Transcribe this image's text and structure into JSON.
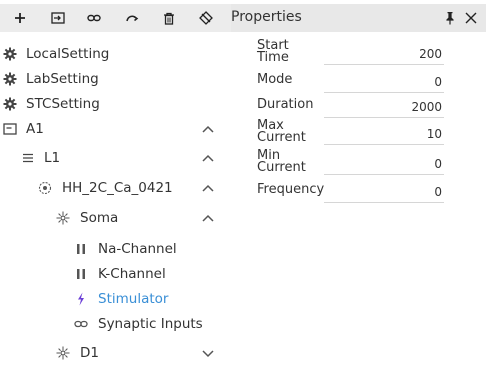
{
  "toolbar": {
    "buttons": [
      "add-icon",
      "import-icon",
      "link-icon",
      "redo-icon",
      "delete-icon",
      "clear-icon"
    ]
  },
  "tree": {
    "items": [
      {
        "label": "LocalSetting",
        "icon": "gear-icon"
      },
      {
        "label": "LabSetting",
        "icon": "gear-icon"
      },
      {
        "label": "STCSetting",
        "icon": "gear-icon"
      },
      {
        "label": "A1",
        "icon": "window-icon",
        "expanded": true
      },
      {
        "label": "L1",
        "icon": "list-icon",
        "expanded": true
      },
      {
        "label": "HH_2C_Ca_0421",
        "icon": "neuron-icon",
        "expanded": true
      },
      {
        "label": "Soma",
        "icon": "cell-icon",
        "expanded": true
      },
      {
        "label": "Na-Channel",
        "icon": "channel-icon"
      },
      {
        "label": "K-Channel",
        "icon": "channel-icon"
      },
      {
        "label": "Stimulator",
        "icon": "lightning-icon",
        "active": true
      },
      {
        "label": "Synaptic Inputs",
        "icon": "link-icon"
      },
      {
        "label": "D1",
        "icon": "cell-icon",
        "expanded": false
      }
    ]
  },
  "properties": {
    "title": "Properties",
    "rows": [
      {
        "label": "Start\nTime",
        "value": "200"
      },
      {
        "label": "Mode",
        "value": "0"
      },
      {
        "label": "Duration",
        "value": "2000"
      },
      {
        "label": "Max\nCurrent",
        "value": "10"
      },
      {
        "label": "Min\nCurrent",
        "value": "0"
      },
      {
        "label": "Frequency",
        "value": "0"
      }
    ]
  },
  "colors": {
    "accent": "#3a8fd6",
    "toolbar_bg": "#ececec",
    "header_bg": "#e8e8e8"
  }
}
